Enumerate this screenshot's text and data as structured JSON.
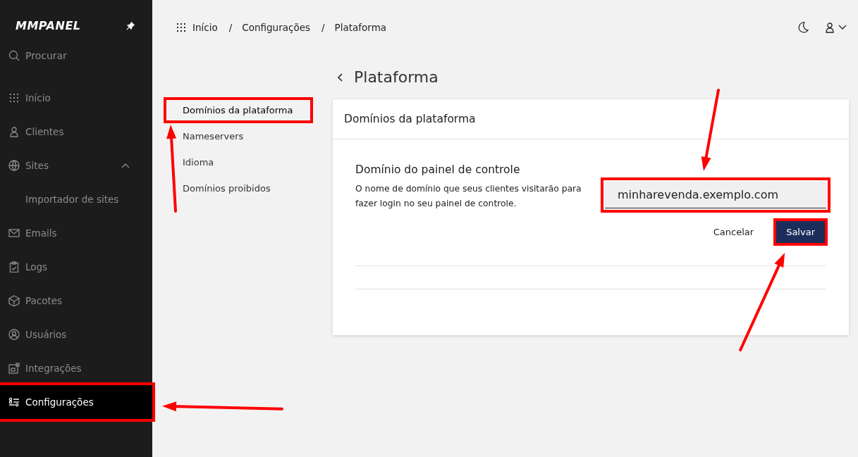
{
  "sidebar": {
    "logo": "MMPANEL",
    "search": {
      "placeholder": "Procurar"
    },
    "items": [
      {
        "kind": "grid",
        "label": "Início",
        "selected": false
      },
      {
        "kind": "person",
        "label": "Clientes",
        "selected": false
      },
      {
        "kind": "globe",
        "label": "Sites",
        "selected": false,
        "expanded": true,
        "children": [
          {
            "label": "Importador de sites",
            "selected": false
          }
        ]
      },
      {
        "kind": "mail",
        "label": "Emails",
        "selected": false
      },
      {
        "kind": "clipboard",
        "label": "Logs",
        "selected": false
      },
      {
        "kind": "box",
        "label": "Pacotes",
        "selected": false
      },
      {
        "kind": "user-circle",
        "label": "Usuários",
        "selected": false
      },
      {
        "kind": "apps",
        "label": "Integrações",
        "selected": false
      },
      {
        "kind": "sliders",
        "label": "Configurações",
        "selected": true,
        "highlight": {
          "kind": "right"
        }
      }
    ]
  },
  "breadcrumb": [
    {
      "kind": "link",
      "label": "Início"
    },
    {
      "kind": "separator",
      "label": "/"
    },
    {
      "kind": "link",
      "label": "Configurações"
    },
    {
      "kind": "separator",
      "label": "/"
    },
    {
      "kind": "link",
      "label": "Plataforma"
    }
  ],
  "page_title": "Plataforma",
  "subnav": [
    {
      "label": "Domínios da plataforma",
      "selected": true,
      "highlight": {
        "kind": "below"
      }
    },
    {
      "label": "Nameservers",
      "selected": false
    },
    {
      "label": "Idioma",
      "selected": false
    },
    {
      "label": "Domínios proibidos",
      "selected": false
    }
  ],
  "card": {
    "title": "Domínios da plataforma",
    "setting": {
      "title": "Domínio do painel de controle",
      "description": "O nome de domínio que seus clientes visitarão para fazer login no seu painel de controle.",
      "value": "minharevenda.exemplo.com",
      "highlight": {
        "kind": "above"
      }
    },
    "buttons": [
      {
        "kind": "secondary",
        "label": "Cancelar"
      },
      {
        "kind": "primary",
        "label": "Salvar",
        "highlight": {
          "kind": "diagonal"
        }
      }
    ]
  }
}
